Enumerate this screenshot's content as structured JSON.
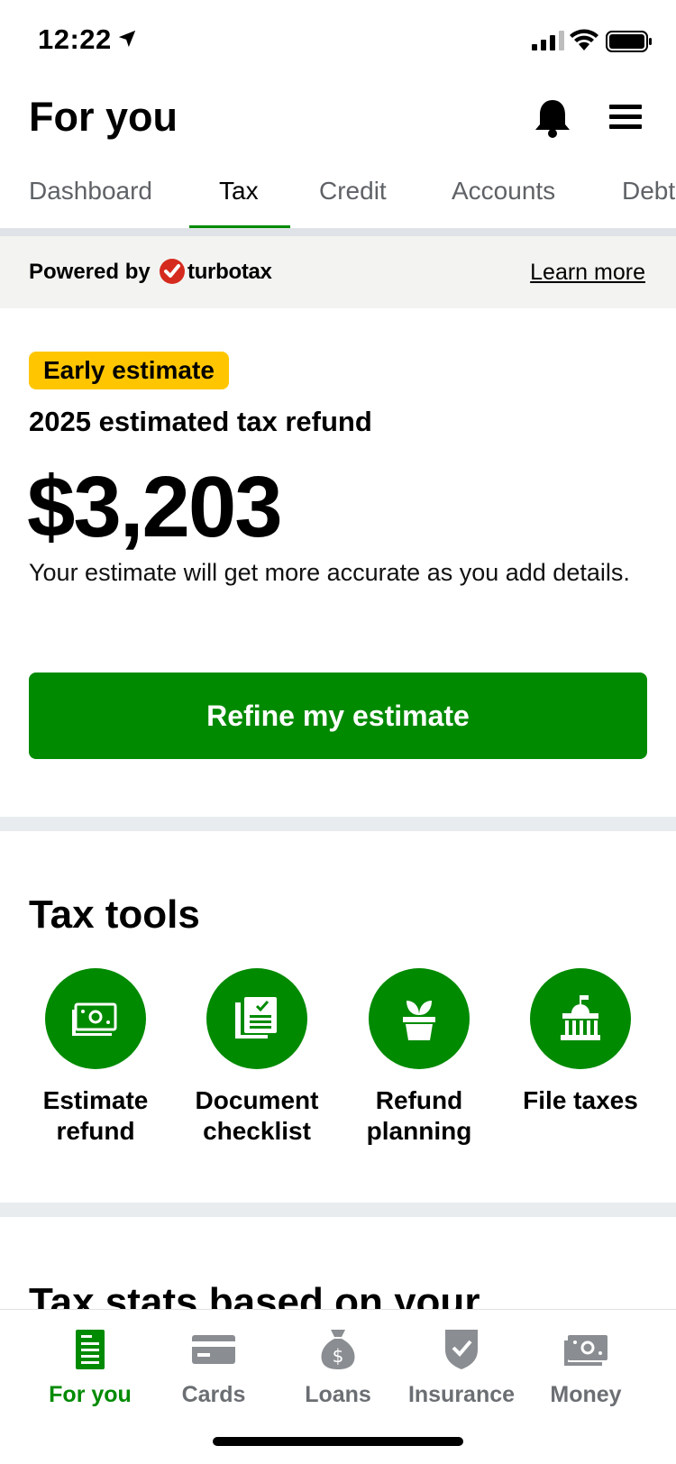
{
  "status_bar": {
    "time": "12:22"
  },
  "header": {
    "title": "For you"
  },
  "tabs": [
    {
      "label": "Dashboard"
    },
    {
      "label": "Tax"
    },
    {
      "label": "Credit"
    },
    {
      "label": "Accounts"
    },
    {
      "label": "Debt"
    }
  ],
  "active_tab": "Tax",
  "powered": {
    "label": "Powered by",
    "brand": "turbotax",
    "learn_more": "Learn more"
  },
  "estimate": {
    "badge": "Early estimate",
    "label": "2025 estimated tax refund",
    "amount": "$3,203",
    "description": "Your estimate will get more accurate as you add details.",
    "button": "Refine my estimate"
  },
  "tax_tools": {
    "title": "Tax tools",
    "items": [
      {
        "label": "Estimate refund",
        "icon": "money-bill-icon"
      },
      {
        "label": "Document checklist",
        "icon": "checklist-icon"
      },
      {
        "label": "Refund planning",
        "icon": "plant-pot-icon"
      },
      {
        "label": "File taxes",
        "icon": "government-building-icon"
      }
    ]
  },
  "tax_stats": {
    "title": "Tax stats based on your"
  },
  "bottom_nav": {
    "items": [
      {
        "label": "For you",
        "icon": "document-icon"
      },
      {
        "label": "Cards",
        "icon": "credit-card-icon"
      },
      {
        "label": "Loans",
        "icon": "money-bag-icon"
      },
      {
        "label": "Insurance",
        "icon": "shield-icon"
      },
      {
        "label": "Money",
        "icon": "cash-icon"
      }
    ],
    "active": "For you"
  },
  "colors": {
    "brand_green": "#008a00",
    "badge_yellow": "#ffc600",
    "turbotax_red": "#d52b1e"
  }
}
